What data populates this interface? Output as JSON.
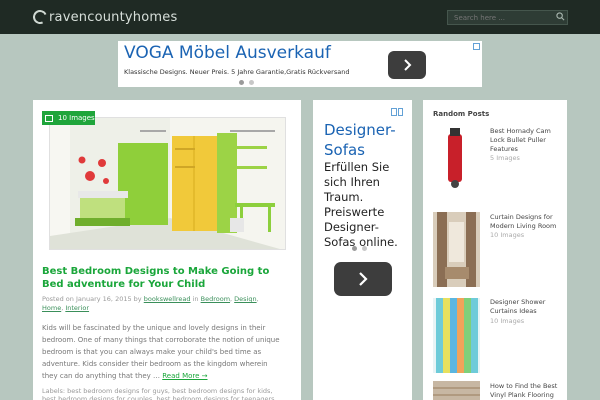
{
  "header": {
    "site_name": "ravencountyhomes",
    "search_placeholder": "Search here ..."
  },
  "ad_top": {
    "headline": "VOGA Möbel Ausverkauf",
    "body": "Klassische Designs. Neuer Preis. 5 Jahre Garantie,Gratis Rückversand"
  },
  "post": {
    "image_count": "10 Images",
    "title": "Best Bedroom Designs to Make Going to Bed adventure for Your Child",
    "meta_prefix": "Posted on January 16, 2015 by",
    "author": "bookswellread",
    "meta_in": "in",
    "categories": [
      "Bedroom",
      "Design",
      "Home",
      "Interior"
    ],
    "excerpt": "Kids will be fascinated by the unique and lovely designs in their bedroom. One of many things that corroborate the notion of unique bedroom is that you can always make your child's bed time as adventure. Kids consider their bedroom as the kingdom wherein they can do anything that they …",
    "read_more": "Read More →",
    "labels": "Labels: best bedroom designs for guys, best bedroom designs for kids, best bedroom designs for couples, best bedroom designs for teenagers, best"
  },
  "ad_mid": {
    "headline": "Designer-Sofas",
    "body": "Erfüllen Sie sich Ihren Traum. Preiswerte Designer-Sofas online."
  },
  "sidebar": {
    "title": "Random Posts",
    "posts": [
      {
        "title": "Best Hornady Cam Lock Bullet Puller Features",
        "count": "5 Images"
      },
      {
        "title": "Curtain Designs for Modern Living Room",
        "count": "10 Images"
      },
      {
        "title": "Designer Shower Curtains Ideas",
        "count": "10 Images"
      },
      {
        "title": "How to Find the Best Vinyl Plank Flooring",
        "count": ""
      }
    ]
  }
}
